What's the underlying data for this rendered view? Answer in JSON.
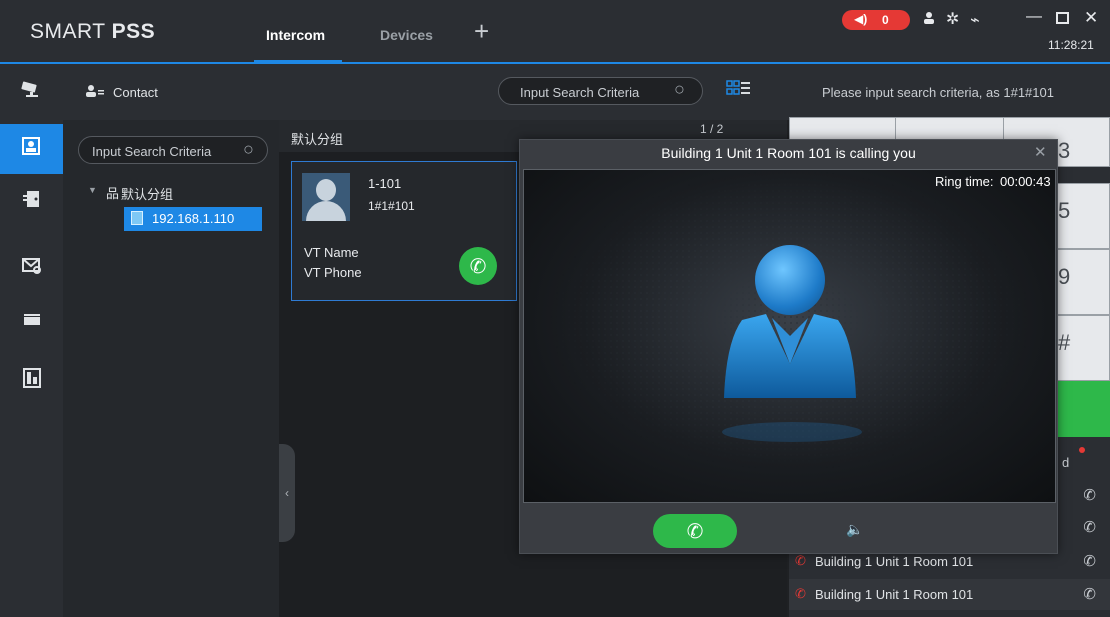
{
  "app": {
    "logo_light": "SMART ",
    "logo_bold": "PSS",
    "clock": "11:28:21"
  },
  "tabs": [
    {
      "label": "Intercom",
      "active": true
    },
    {
      "label": "Devices",
      "active": false
    }
  ],
  "tab_add": "+",
  "alarm": {
    "count": "0",
    "color": "#e53935"
  },
  "contact": {
    "title": "Contact"
  },
  "tree": {
    "search_placeholder": "Input Search Criteria",
    "group_label": "默认分组",
    "device_label": "192.168.1.110"
  },
  "top_search": {
    "placeholder": "Input Search Criteria"
  },
  "group_bar": {
    "title": "默认分组",
    "page": "1 / 2"
  },
  "card": {
    "room": "1-101",
    "code": "1#1#101",
    "vt_name": "VT Name",
    "vt_phone": "VT Phone"
  },
  "right_panel": {
    "hint": "Please input search criteria, as 1#1#101",
    "keypad_visible": [
      "3",
      "5",
      "9",
      "#"
    ],
    "partial_label": "d",
    "calls": [
      {
        "label": "Building 1 Unit 1 Room 101"
      },
      {
        "label": "Building 1 Unit 1 Room 101"
      }
    ]
  },
  "modal": {
    "title": "Building 1 Unit 1 Room 101 is calling you",
    "ring_label": "Ring time:",
    "ring_time": "00:00:43"
  },
  "colors": {
    "accent": "#1e88e5",
    "green": "#2eb84a",
    "red": "#e53935"
  }
}
